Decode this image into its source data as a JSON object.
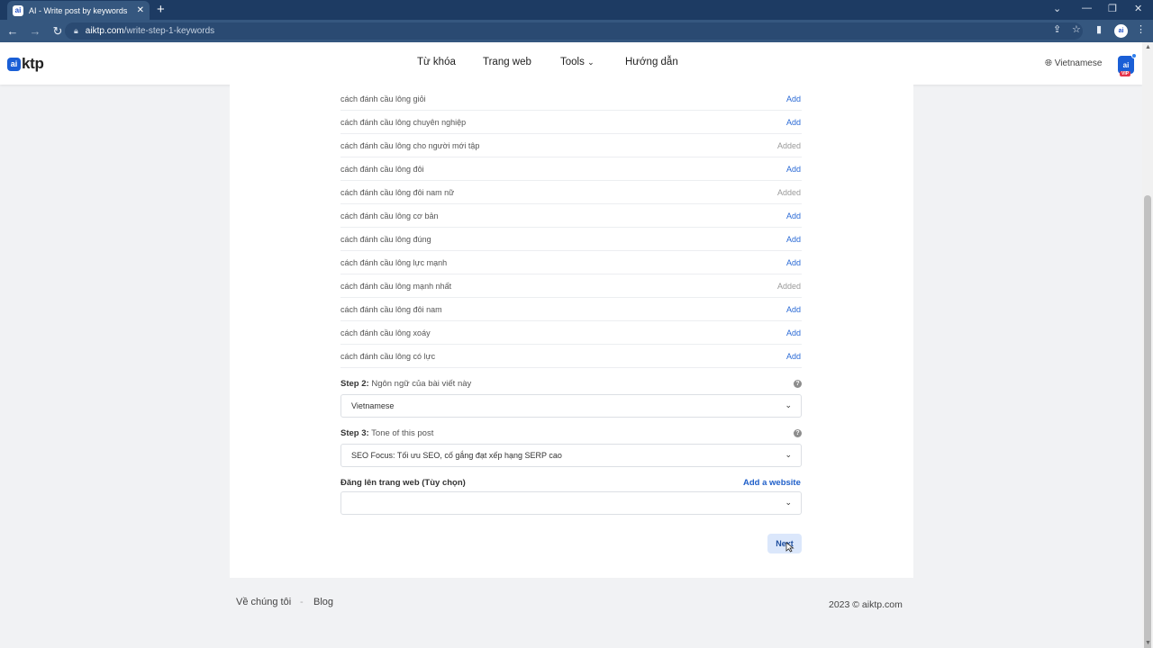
{
  "browser": {
    "tab_title": "AI - Write post by keywords",
    "tab_favicon": "ai",
    "url_domain": "aiktp.com",
    "url_path": "/write-step-1-keywords"
  },
  "header": {
    "logo_badge": "ai",
    "logo_text": "ktp",
    "nav": {
      "keywords": "Từ khóa",
      "websites": "Trang web",
      "tools": "Tools",
      "guide": "Hướng dẫn"
    },
    "language": "Vietnamese",
    "avatar_text": "ai",
    "avatar_badge": "VIP"
  },
  "keywords": [
    {
      "text": "cách đánh cầu lông giỏi",
      "action": "Add",
      "added": false
    },
    {
      "text": "cách đánh cầu lông chuyên nghiệp",
      "action": "Add",
      "added": false
    },
    {
      "text": "cách đánh cầu lông cho người mới tập",
      "action": "Added",
      "added": true
    },
    {
      "text": "cách đánh cầu lông đôi",
      "action": "Add",
      "added": false
    },
    {
      "text": "cách đánh cầu lông đôi nam nữ",
      "action": "Added",
      "added": true
    },
    {
      "text": "cách đánh cầu lông cơ bản",
      "action": "Add",
      "added": false
    },
    {
      "text": "cách đánh cầu lông đúng",
      "action": "Add",
      "added": false
    },
    {
      "text": "cách đánh cầu lông lực mạnh",
      "action": "Add",
      "added": false
    },
    {
      "text": "cách đánh cầu lông mạnh nhất",
      "action": "Added",
      "added": true
    },
    {
      "text": "cách đánh cầu lông đôi nam",
      "action": "Add",
      "added": false
    },
    {
      "text": "cách đánh cầu lông xoáy",
      "action": "Add",
      "added": false
    },
    {
      "text": "cách đánh cầu lông có lực",
      "action": "Add",
      "added": false
    }
  ],
  "step2": {
    "label_bold": "Step 2:",
    "label": " Ngôn ngữ của bài viết này",
    "value": "Vietnamese"
  },
  "step3": {
    "label_bold": "Step 3:",
    "label": " Tone of this post",
    "value": "SEO Focus: Tối ưu SEO, cố gắng đạt xếp hạng SERP cao"
  },
  "publish": {
    "label": "Đăng lên trang web (Tùy chọn)",
    "add_website": "Add a website",
    "value": ""
  },
  "next_button": "Next",
  "footer": {
    "about": "Về chúng tôi",
    "separator": "-",
    "blog": "Blog",
    "copyright": "2023 © aiktp.com"
  },
  "colors": {
    "accent": "#1f5fc9",
    "browser_chrome": "#1d3b63",
    "added_gray": "#9a9a9a"
  }
}
